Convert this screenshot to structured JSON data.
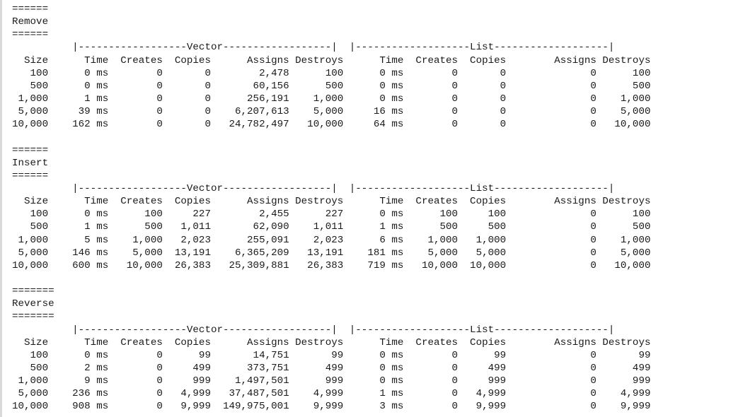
{
  "console": {
    "lines": [
      "======",
      "Remove",
      "======",
      "          |------------------Vector------------------|  |-------------------List-------------------|",
      "  Size      Time  Creates  Copies      Assigns Destroys      Time  Creates  Copies        Assigns Destroys",
      "   100      0 ms        0       0        2,478      100      0 ms        0       0              0      100",
      "   500      0 ms        0       0       60,156      500      0 ms        0       0              0      500",
      " 1,000      1 ms        0       0      256,191    1,000      0 ms        0       0              0    1,000",
      " 5,000     39 ms        0       0    6,207,613    5,000     16 ms        0       0              0    5,000",
      "10,000    162 ms        0       0   24,782,497   10,000     64 ms        0       0              0   10,000",
      "",
      "======",
      "Insert",
      "======",
      "          |------------------Vector------------------|  |-------------------List-------------------|",
      "  Size      Time  Creates  Copies      Assigns Destroys      Time  Creates  Copies        Assigns Destroys",
      "   100      0 ms      100     227        2,455      227      0 ms      100     100              0      100",
      "   500      1 ms      500   1,011       62,090    1,011      1 ms      500     500              0      500",
      " 1,000      5 ms    1,000   2,023      255,091    2,023      6 ms    1,000   1,000              0    1,000",
      " 5,000    146 ms    5,000  13,191    6,365,209   13,191    181 ms    5,000   5,000              0    5,000",
      "10,000    600 ms   10,000  26,383   25,309,881   26,383    719 ms   10,000  10,000              0   10,000",
      "",
      "=======",
      "Reverse",
      "=======",
      "          |------------------Vector------------------|  |-------------------List-------------------|",
      "  Size      Time  Creates  Copies      Assigns Destroys      Time  Creates  Copies        Assigns Destroys",
      "   100      0 ms        0      99       14,751       99      0 ms        0      99              0       99",
      "   500      2 ms        0     499      373,751      499      0 ms        0     499              0      499",
      " 1,000      9 ms        0     999    1,497,501      999      0 ms        0     999              0      999",
      " 5,000    236 ms        0   4,999   37,487,501    4,999      1 ms        0   4,999              0    4,999",
      "10,000    908 ms        0   9,999  149,975,001    9,999      3 ms        0   9,999              0    9,999"
    ]
  }
}
